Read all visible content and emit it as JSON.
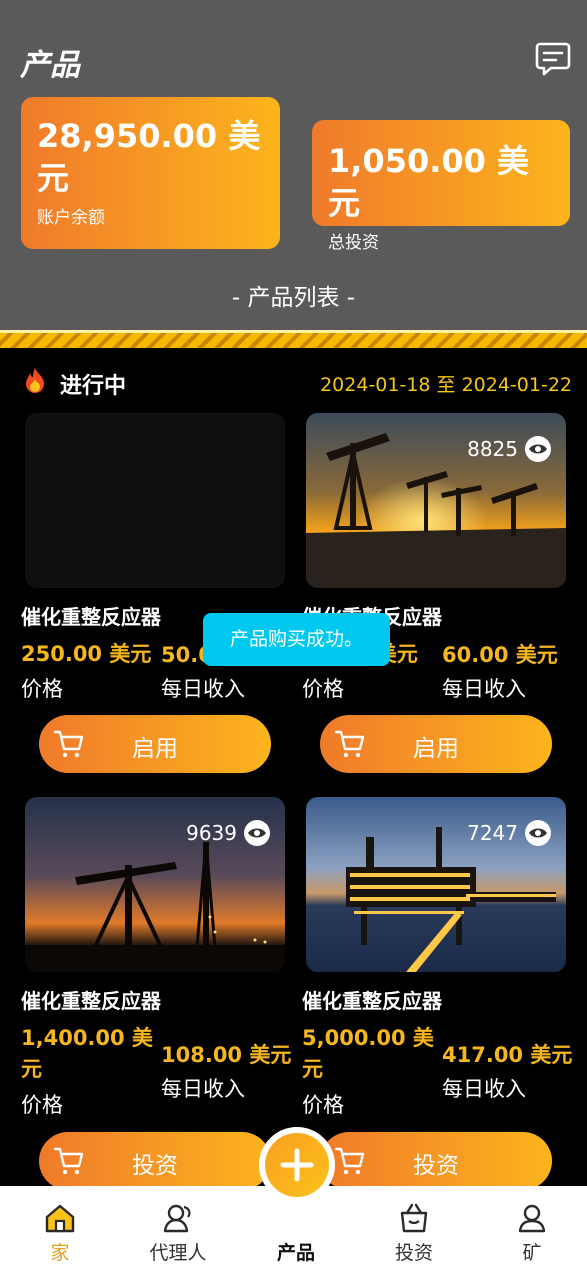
{
  "header": {
    "title": "产品",
    "balance_amount": "28,950.00 美元",
    "balance_label": "账户余额",
    "invest_amount": "1,050.00 美元",
    "invest_label": "总投资",
    "list_title": "- 产品列表 -"
  },
  "status": {
    "label": "进行中",
    "date_range": "2024-01-18 至 2024-01-22"
  },
  "products": [
    {
      "views": "",
      "name": "催化重整反应器",
      "price": "250.00 美元",
      "price_label": "价格",
      "daily": "50.00 美元",
      "daily_label": "每日收入",
      "button": "启用",
      "image": "empty"
    },
    {
      "views": "8825",
      "name": "催化重整反应器",
      "price": "50.00 美元",
      "price_label": "价格",
      "daily": "60.00 美元",
      "daily_label": "每日收入",
      "button": "启用",
      "image": "oil-pumps-sunset"
    },
    {
      "views": "9639",
      "name": "催化重整反应器",
      "price": "1,400.00 美元",
      "price_label": "价格",
      "daily": "108.00 美元",
      "daily_label": "每日收入",
      "button": "投资",
      "image": "oil-pump-dusk"
    },
    {
      "views": "7247",
      "name": "催化重整反应器",
      "price": "5,000.00 美元",
      "price_label": "价格",
      "daily": "417.00 美元",
      "daily_label": "每日收入",
      "button": "投资",
      "image": "offshore-platform"
    }
  ],
  "toast": "产品购买成功。",
  "tabbar": {
    "items": [
      {
        "label": "家",
        "icon": "home-icon",
        "active": true
      },
      {
        "label": "代理人",
        "icon": "agent-icon"
      },
      {
        "label": "产品",
        "icon": "plus-icon"
      },
      {
        "label": "投资",
        "icon": "shopping-bag-icon"
      },
      {
        "label": "矿",
        "icon": "user-icon"
      }
    ]
  },
  "colors": {
    "accent_start": "#f07a2b",
    "accent_end": "#fcb51c",
    "price": "#f5b61f",
    "toast": "#00c8ef",
    "header_bg": "#5a5a5a"
  }
}
